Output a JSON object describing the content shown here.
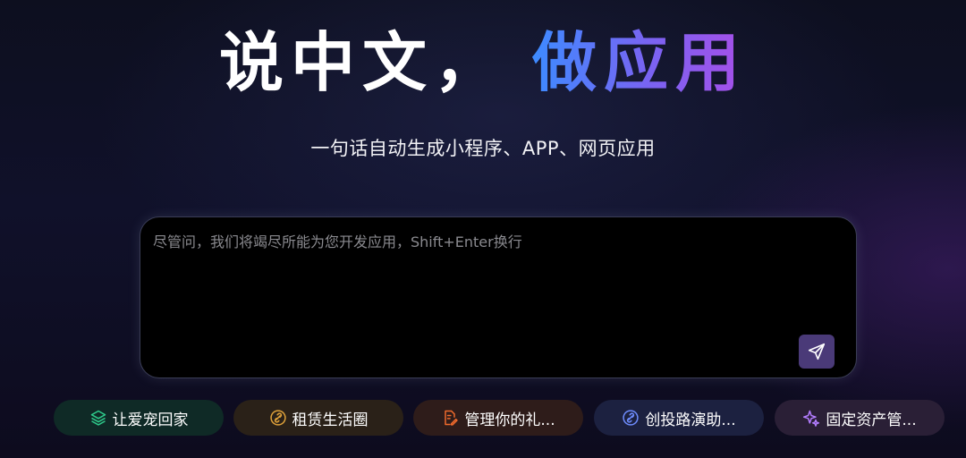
{
  "hero": {
    "title_white": "说中文，",
    "title_gradient": "做应用",
    "subtitle": "一句话自动生成小程序、APP、网页应用"
  },
  "prompt": {
    "placeholder": "尽管问，我们将竭尽所能为您开发应用，Shift+Enter换行",
    "value": ""
  },
  "suggestions": [
    {
      "label": "让爱宠回家",
      "icon": "layers-icon",
      "color": "#2ec98a"
    },
    {
      "label": "租赁生活圈",
      "icon": "link-icon",
      "color": "#e0a23a"
    },
    {
      "label": "管理你的礼...",
      "icon": "document-edit-icon",
      "color": "#ef6a2c"
    },
    {
      "label": "创投路演助...",
      "icon": "link-icon",
      "color": "#6f8dff"
    },
    {
      "label": "固定资产管...",
      "icon": "sparkle-icon",
      "color": "#b37dff"
    }
  ],
  "colors": {
    "accent_start": "#3d8bff",
    "accent_end": "#a74fe8",
    "send_button": "#4a3a78"
  }
}
